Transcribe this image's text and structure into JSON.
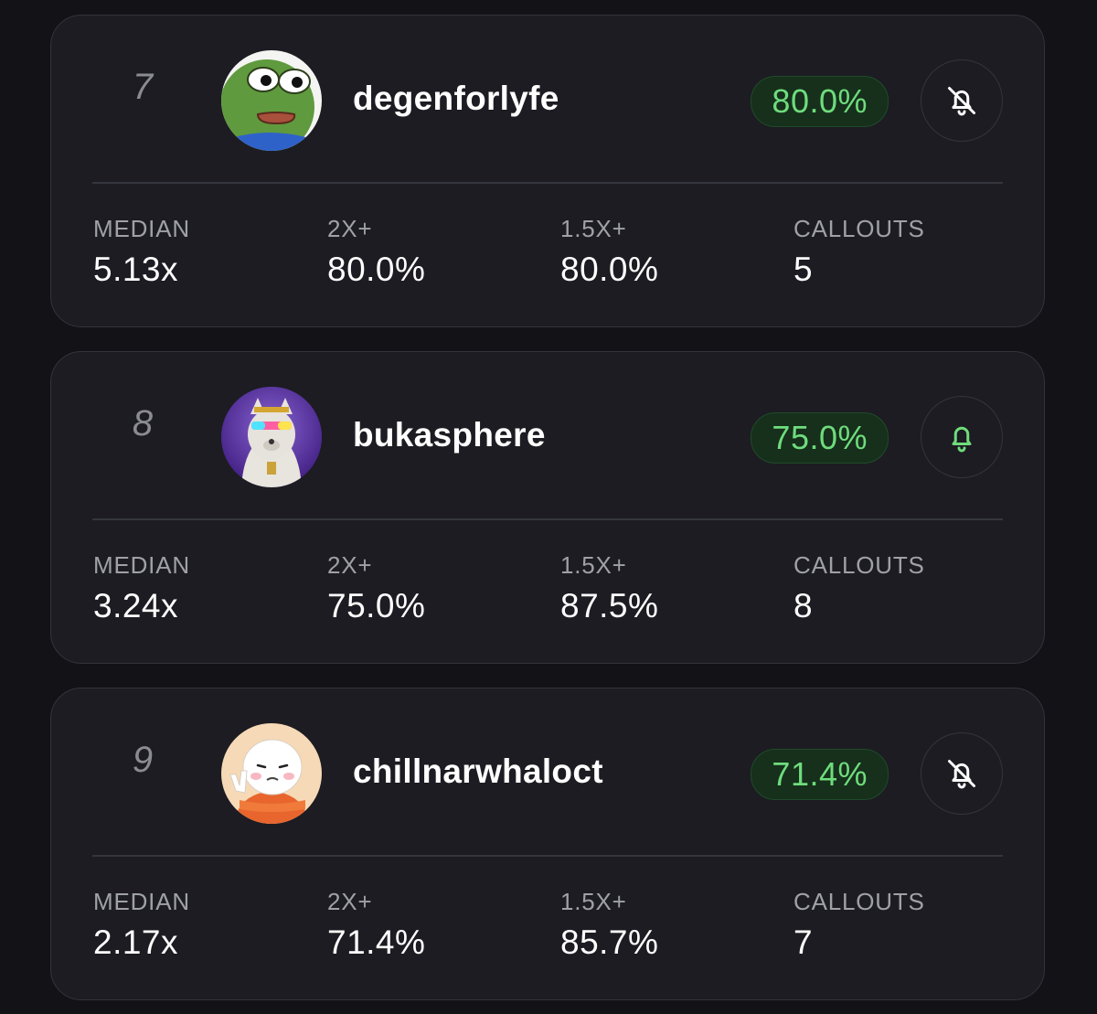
{
  "cards": [
    {
      "rank": "7",
      "username": "degenforlyfe",
      "win_rate": "80.0%",
      "notifications": "muted",
      "avatar_icon": "pepe-frog-avatar",
      "stats": [
        {
          "label": "MEDIAN",
          "value": "5.13x"
        },
        {
          "label": "2X+",
          "value": "80.0%"
        },
        {
          "label": "1.5X+",
          "value": "80.0%"
        },
        {
          "label": "CALLOUTS",
          "value": "5"
        }
      ]
    },
    {
      "rank": "8",
      "username": "bukasphere",
      "win_rate": "75.0%",
      "notifications": "active",
      "avatar_icon": "husky-dog-avatar",
      "stats": [
        {
          "label": "MEDIAN",
          "value": "3.24x"
        },
        {
          "label": "2X+",
          "value": "75.0%"
        },
        {
          "label": "1.5X+",
          "value": "87.5%"
        },
        {
          "label": "CALLOUTS",
          "value": "8"
        }
      ]
    },
    {
      "rank": "9",
      "username": "chillnarwhaloct",
      "win_rate": "71.4%",
      "notifications": "muted",
      "avatar_icon": "cartoon-character-avatar",
      "stats": [
        {
          "label": "MEDIAN",
          "value": "2.17x"
        },
        {
          "label": "2X+",
          "value": "71.4%"
        },
        {
          "label": "1.5X+",
          "value": "85.7%"
        },
        {
          "label": "CALLOUTS",
          "value": "7"
        }
      ]
    }
  ],
  "colors": {
    "background": "#121217",
    "card": "#1c1c22",
    "accent_green": "#6fdc7c",
    "badge_bg": "#16301c",
    "muted_text": "#a0a0a8"
  }
}
